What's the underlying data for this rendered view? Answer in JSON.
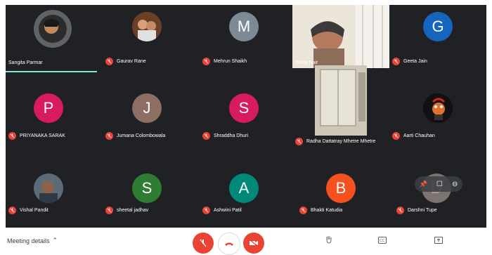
{
  "participants": [
    {
      "name": "Sangita Parmar",
      "initial": "",
      "type": "photo"
    },
    {
      "name": "Gaurav Rane",
      "initial": "",
      "type": "photo"
    },
    {
      "name": "Mehrun Shaikh",
      "initial": "M",
      "color": "#7d8a96"
    },
    {
      "name": "Indira Nair",
      "initial": "",
      "type": "video"
    },
    {
      "name": "Geeta Jain",
      "initial": "G",
      "color": "#1565c0"
    },
    {
      "name": "PRIYANAKA SARAK",
      "initial": "P",
      "color": "#d81b60"
    },
    {
      "name": "Jumana Colombowala",
      "initial": "J",
      "color": "#8d6e63"
    },
    {
      "name": "Shraddha Dhuri",
      "initial": "S",
      "color": "#d81b60"
    },
    {
      "name": "Radha Dattatray Mhetre Mhetre",
      "initial": "",
      "type": "video"
    },
    {
      "name": "Aarti Chauhan",
      "initial": "",
      "type": "photo"
    },
    {
      "name": "Vishal Pandit",
      "initial": "",
      "type": "photo"
    },
    {
      "name": "sheetal jadhav",
      "initial": "S",
      "color": "#2e7d32"
    },
    {
      "name": "Ashwini Patil",
      "initial": "A",
      "color": "#00897b"
    },
    {
      "name": "Bhakti Katudia",
      "initial": "B",
      "color": "#f4511e"
    },
    {
      "name": "Darshni Tupe",
      "initial": "D",
      "color": "#bcaaa4"
    }
  ],
  "bottom": {
    "meeting_details": "Meeting details",
    "mic_icon": "mic-off-icon",
    "hangup_icon": "call-end-icon",
    "cam_icon": "camera-off-icon",
    "raise_hand_icon": "hand-icon",
    "cc_icon": "captions-icon",
    "present_icon": "present-icon"
  }
}
